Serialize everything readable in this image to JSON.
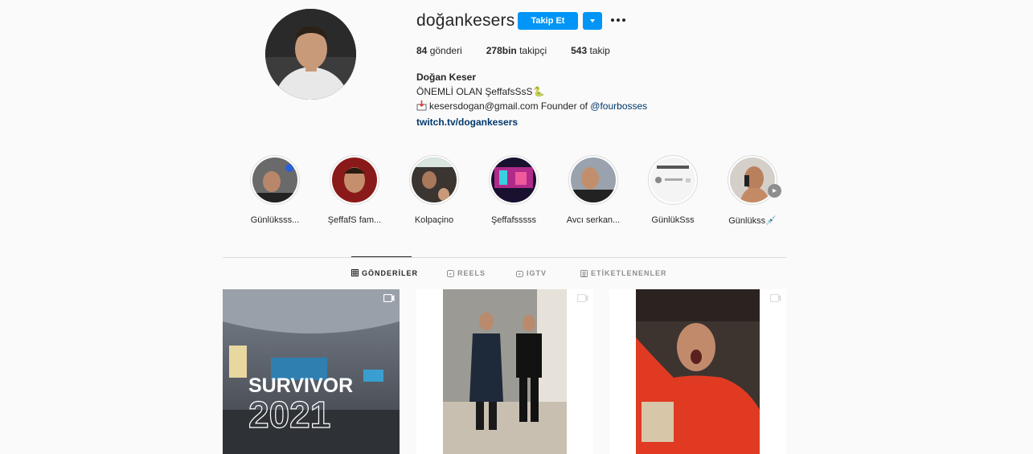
{
  "profile": {
    "username": "doğankesers",
    "follow_label": "Takip Et",
    "stats": {
      "posts_count": "84",
      "posts_label": "gönderi",
      "followers_count": "278bin",
      "followers_label": "takipçi",
      "following_count": "543",
      "following_label": "takip"
    },
    "bio": {
      "name": "Doğan Keser",
      "line1": "ÖNEMLİ OLAN ŞeffafsSsS🐍",
      "email_text": "kesersdogan@gmail.com Founder of ",
      "mention": "@fourbosses",
      "link": "twitch.tv/dogankesers"
    }
  },
  "highlights": [
    {
      "label": "Günlüksss..."
    },
    {
      "label": "ŞeffafS fam..."
    },
    {
      "label": "Kolpaçino"
    },
    {
      "label": "Şeffafsssss"
    },
    {
      "label": "Avcı serkan..."
    },
    {
      "label": "GünlükSss"
    },
    {
      "label": "Günlükss💉"
    }
  ],
  "tabs": [
    {
      "label": "GÖNDERİLER",
      "icon": "grid-icon"
    },
    {
      "label": "REELS",
      "icon": "reels-icon"
    },
    {
      "label": "IGTV",
      "icon": "igtv-icon"
    },
    {
      "label": "ETİKETLENENLER",
      "icon": "tagged-icon"
    }
  ],
  "posts": [
    {
      "overlay_text_1": "SURVIVOR",
      "overlay_text_2": "2021",
      "type": "video"
    },
    {
      "type": "video"
    },
    {
      "type": "video"
    }
  ],
  "colors": {
    "accent": "#0095f6",
    "background": "#fafafa",
    "link": "#00376b",
    "muted": "#8e8e8e"
  }
}
